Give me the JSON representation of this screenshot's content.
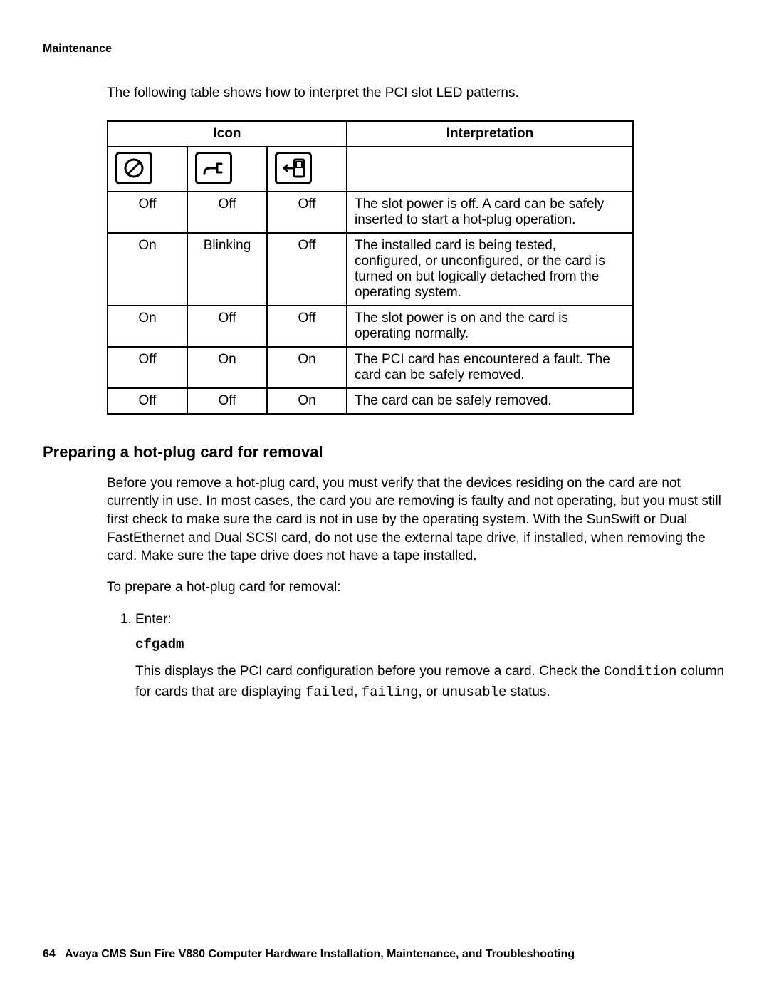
{
  "header": {
    "running_head": "Maintenance"
  },
  "intro": "The following table shows how to interpret the PCI slot LED patterns.",
  "table": {
    "head_icon": "Icon",
    "head_interp": "Interpretation",
    "icon_names": [
      "power-off-icon",
      "plug-icon",
      "removal-ok-icon"
    ],
    "rows": [
      {
        "c1": "Off",
        "c2": "Off",
        "c3": "Off",
        "interp": "The slot power is off. A card can be safely inserted to start a hot-plug operation."
      },
      {
        "c1": "On",
        "c2": "Blinking",
        "c3": "Off",
        "interp": "The installed card is being tested, configured, or unconfigured, or the card is turned on but logically detached from the operating system."
      },
      {
        "c1": "On",
        "c2": "Off",
        "c3": "Off",
        "interp": "The slot power is on and the card is operating normally."
      },
      {
        "c1": "Off",
        "c2": "On",
        "c3": "On",
        "interp": "The PCI card has encountered a fault. The card can be safely removed."
      },
      {
        "c1": "Off",
        "c2": "Off",
        "c3": "On",
        "interp": "The card can be safely removed."
      }
    ]
  },
  "section": {
    "title": "Preparing a hot-plug card for removal",
    "para1": "Before you remove a hot-plug card, you must verify that the devices residing on the card are not currently in use. In most cases, the card you are removing is faulty and not operating, but you must still first check to make sure the card is not in use by the operating system. With the SunSwift or Dual FastEthernet and Dual SCSI card, do not use the external tape drive, if installed, when removing the card. Make sure the tape drive does not have a tape installed.",
    "para2": "To prepare a hot-plug card for removal:",
    "step1_label": "Enter:",
    "step1_cmd": "cfgadm",
    "step1_after_a": "This displays the PCI card configuration before you remove a card. Check the ",
    "step1_after_cond": "Condition",
    "step1_after_b": " column for cards that are displaying ",
    "step1_failed": "failed",
    "step1_sep1": ", ",
    "step1_failing": "failing",
    "step1_sep2": ", or ",
    "step1_unusable": "unusable",
    "step1_after_c": " status."
  },
  "footer": {
    "page": "64",
    "title": "Avaya CMS Sun Fire V880 Computer Hardware Installation, Maintenance, and Troubleshooting"
  }
}
